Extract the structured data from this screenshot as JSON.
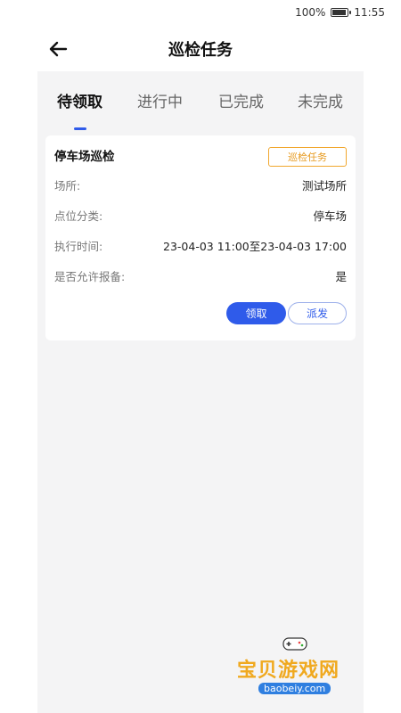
{
  "status_bar": {
    "battery_text": "100%",
    "time": "11:55",
    "battery_level": 1.0
  },
  "header": {
    "title": "巡检任务"
  },
  "tabs": [
    {
      "label": "待领取",
      "active": true
    },
    {
      "label": "进行中",
      "active": false
    },
    {
      "label": "已完成",
      "active": false
    },
    {
      "label": "未完成",
      "active": false
    }
  ],
  "task_card": {
    "title": "停车场巡检",
    "tag": "巡检任务",
    "rows": [
      {
        "label": "场所:",
        "value": "测试场所"
      },
      {
        "label": "点位分类:",
        "value": "停车场"
      },
      {
        "label": "执行时间:",
        "value": "23-04-03 11:00至23-04-03 17:00"
      },
      {
        "label": "是否允许报备:",
        "value": "是"
      }
    ],
    "claim_label": "领取",
    "dispatch_label": "派发"
  },
  "watermark": {
    "text": "宝贝游戏网",
    "url": "baobeiy.com"
  },
  "colors": {
    "accent": "#2f5bea",
    "tag": "#f1a72e",
    "panel_bg": "#f4f4f5"
  }
}
